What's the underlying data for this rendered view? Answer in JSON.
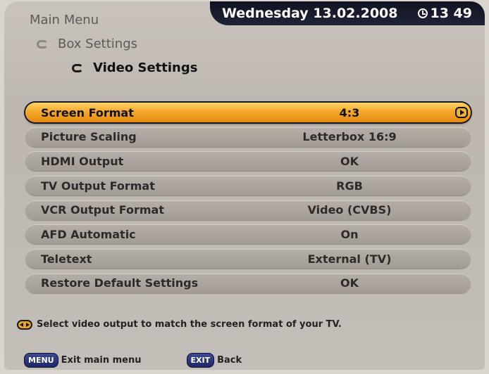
{
  "header": {
    "date": "Wednesday 13.02.2008",
    "time": "13 49"
  },
  "breadcrumb": {
    "main": "Main Menu",
    "box": "Box Settings",
    "current": "Video Settings"
  },
  "settings": [
    {
      "label": "Screen Format",
      "value": "4:3",
      "selected": true
    },
    {
      "label": "Picture Scaling",
      "value": "Letterbox 16:9"
    },
    {
      "label": "HDMI Output",
      "value": "OK"
    },
    {
      "label": "TV Output Format",
      "value": "RGB"
    },
    {
      "label": "VCR Output Format",
      "value": "Video (CVBS)"
    },
    {
      "label": "AFD Automatic",
      "value": "On"
    },
    {
      "label": "Teletext",
      "value": "External (TV)"
    },
    {
      "label": "Restore Default Settings",
      "value": "OK"
    }
  ],
  "hint": "Select video output to match the screen format of your TV.",
  "footer": {
    "menu_key": "MENU",
    "menu_label": "Exit main menu",
    "exit_key": "EXIT",
    "exit_label": "Back"
  },
  "colors": {
    "selected_row": "#f4a92c",
    "row": "#a39c95",
    "datebar": "#0f1220",
    "keycap": "#1e2668"
  }
}
